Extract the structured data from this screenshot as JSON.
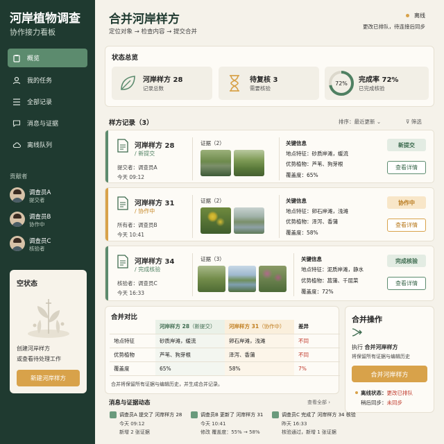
{
  "app": {
    "title": "河岸植物调查",
    "subtitle": "协作接力看板"
  },
  "nav": [
    {
      "label": "概览",
      "icon": "clipboard-icon"
    },
    {
      "label": "我的任务",
      "icon": "user-icon"
    },
    {
      "label": "全部记录",
      "icon": "list-icon"
    },
    {
      "label": "消息与证据",
      "icon": "chat-icon"
    },
    {
      "label": "离线队列",
      "icon": "cloud-icon"
    }
  ],
  "contributors": {
    "label": "贡献者",
    "people": [
      {
        "name": "调查员A",
        "role": "提交者"
      },
      {
        "name": "调查员B",
        "role": "协作中"
      },
      {
        "name": "调查员C",
        "role": "核验者"
      }
    ]
  },
  "empty_state": {
    "title": "空状态",
    "desc1": "创建河岸样方",
    "desc2": "或查看待处理工作",
    "button": "新建河岸样方"
  },
  "header": {
    "title": "合并河岸样方",
    "steps": "定位对象 → 检查内容 → 提交合并",
    "offline_label": "离线",
    "offline_desc": "更改已排队，待连接后同步"
  },
  "status": {
    "title": "状态总览",
    "tiles": [
      {
        "value": "河岸样方 28",
        "label": "记录总数"
      },
      {
        "value": "待复核 3",
        "label": "需要核验"
      },
      {
        "value": "完成率 72%",
        "label": "已完成核验",
        "ring": "72%"
      }
    ],
    "progress": 0.72
  },
  "records": {
    "title": "样方记录（3）",
    "sort": "排序：",
    "sort_value": "最近更新",
    "filter": "筛选",
    "evidence": "证据",
    "key_info": "关键信息",
    "detail": "查看详情",
    "items": [
      {
        "title": "河岸样方 28",
        "status": "/ 新提交",
        "meta1": "提交者：调查员A",
        "meta2": "今天 09:12",
        "ev_count": "（2）",
        "k1": "地点特征：砂质岸滩，缓流",
        "k2": "优势植物：芦苇、狗芽根",
        "k3": "覆盖度：65%",
        "pill": "新提交",
        "color": "#5c8b6e"
      },
      {
        "title": "河岸样方 31",
        "status": "/ 协作中",
        "meta1": "所有者：调查员B",
        "meta2": "今天 10:41",
        "ev_count": "（2）",
        "k1": "地点特征：卵石岸滩，浅滩",
        "k2": "优势植物：泽泻、香蒲",
        "k3": "覆盖度：58%",
        "pill": "协作中",
        "color": "#d8a24a"
      },
      {
        "title": "河岸样方 34",
        "status": "/ 完成核验",
        "meta1": "核验者：调查员C",
        "meta2": "今天 16:33",
        "ev_count": "（3）",
        "k1": "关键信息",
        "k2": "地点特征：泥质岸滩，静水",
        "k3": "优势植物：菖蒲、千屈菜",
        "k4": "覆盖度：72%",
        "pill": "完成核验",
        "color": "#5c8b6e"
      }
    ]
  },
  "compare": {
    "title": "合并对比",
    "h1a": "河岸样方 28",
    "h1b": "（新提交）",
    "h2a": "河岸样方 31",
    "h2b": "（协作中）",
    "h3": "差异",
    "rows": [
      {
        "f": "地点特征",
        "a": "砂质岸滩，缓流",
        "b": "卵石岸滩，浅滩",
        "d": "不同"
      },
      {
        "f": "优势植物",
        "a": "芦苇、狗芽根",
        "b": "泽泻、香蒲",
        "d": "不同"
      },
      {
        "f": "覆盖度",
        "a": "65%",
        "b": "58%",
        "d": "7%"
      }
    ],
    "note": "合并将保留所有证据与编辑历史，并生成合并记录。"
  },
  "merge": {
    "title": "合并操作",
    "exec_prefix": "执行",
    "exec_target": "合并河岸样方",
    "desc": "将保留所有证据与编辑历史",
    "button": "合并河岸样方",
    "offline_label": "离线状态：",
    "offline_value": "更改已排队",
    "sync_label": "稍后同步：",
    "sync_value": "未同步"
  },
  "activity": {
    "title": "消息与证据动态",
    "view_all": "查看全部 ›",
    "items": [
      {
        "line": "调查员A 提交了 河岸样方 28",
        "time": "今天 09:12",
        "note": "新增 2 张证据"
      },
      {
        "line": "调查员B 更新了 河岸样方 31",
        "time": "今天 10:41",
        "note": "修改 覆盖度：55% → 58%"
      },
      {
        "line": "调查员C 完成了 河岸样方 34 核验",
        "time": "昨天 16:33",
        "note": "核验通过，新增 1 张证据"
      }
    ]
  }
}
